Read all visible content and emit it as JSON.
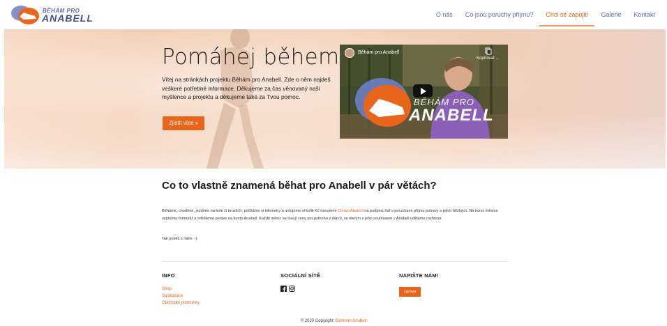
{
  "nav": {
    "logo_small": "BĚHÁM PRO",
    "logo_big": "ANABELL",
    "items": [
      {
        "label": "O nás",
        "active": false
      },
      {
        "label": "Co jsou poruchy příjmu?",
        "active": false
      },
      {
        "label": "Chci se zapojit!",
        "active": true
      },
      {
        "label": "Galerie",
        "active": false
      },
      {
        "label": "Kontakt",
        "active": false
      }
    ]
  },
  "hero": {
    "title": "Pomáhej během!",
    "text": "Vítej na stránkách projektu Běhám pro Anabell. Zde o něm najdeš veškeré potřebné informace. Děkujeme za čas věnovaný naší myšlence a projektu a děkujeme také za Tvou pomoc.",
    "button": "Zjistit více »",
    "video": {
      "title": "Běhám pro Anabell",
      "copy_label": "Kopírovat ...",
      "brand_small": "BĚHÁM PRO",
      "brand_big": "ANABELL"
    }
  },
  "content": {
    "heading": "Co to vlastně znamená běhat pro Anabell v pár větách?",
    "para_before_link": "Běháme, chodíme, jezdíme na kole či bruslích, počítáme si kilometry a určujeme si kolik Kč darujeme ",
    "para_link": "Centru Anabell",
    "para_after_link": " na podporu lidí s poruchami příjmu potravy a jejich blízkých. Na konci měsíce vyplníme formulář a odešleme peníze na konto Anabell. Každý měsíc se losují ceny pro jednoho z dárců, se kterým s jeho souhlasem v Anabell uděláme rozhovor.",
    "para2": "Tak poběž s námi :-)."
  },
  "footer": {
    "info_title": "INFO",
    "info_links": [
      "Shop",
      "Spolupráce",
      "Obchodní podmínky"
    ],
    "social_title": "SOCIÁLNÍ SÍTĚ",
    "social_icons": [
      "facebook-icon",
      "instagram-icon"
    ],
    "write_title": "NAPIŠTE NÁM!",
    "write_button": "Zpráva",
    "copyright_prefix": "© 2020 Copyright: ",
    "copyright_link": "Centrum Anabell"
  },
  "colors": {
    "accent": "#e8651b",
    "nav_link": "#5a6fb2",
    "logo_blue": "#3d4f8f"
  }
}
